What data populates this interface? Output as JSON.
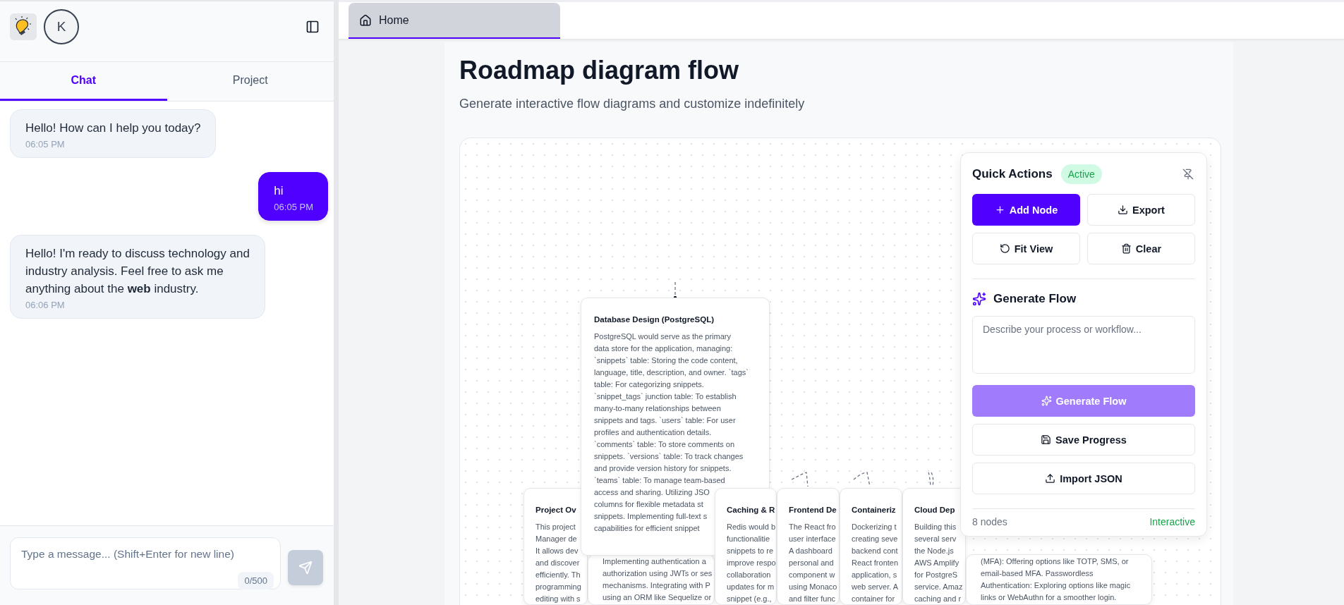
{
  "sidebar": {
    "avatar": "K",
    "tabs": [
      {
        "label": "Chat",
        "selected": true
      },
      {
        "label": "Project",
        "selected": false
      }
    ],
    "messages": [
      {
        "kind": "received",
        "text": "Hello! How can I help you today?",
        "time": "06:05 PM"
      },
      {
        "kind": "sent",
        "text": "hi",
        "time": "06:05 PM"
      },
      {
        "kind": "received",
        "text": "Hello! I'm ready to discuss technology and industry analysis. Feel free to ask me anything about the **web** industry.",
        "time": "06:06 PM"
      }
    ],
    "composer": {
      "placeholder": "Type a message... (Shift+Enter for new line)",
      "count": "0/500",
      "send_disabled": true
    }
  },
  "tabs": [
    {
      "label": "Home",
      "selected": true
    }
  ],
  "page": {
    "title": "Roadmap diagram flow",
    "subtitle": "Generate interactive flow diagrams and customize indefinitely"
  },
  "diagram": {
    "nodes": [
      {
        "title": "Database Design (PostgreSQL)",
        "lines": [
          "PostgreSQL would serve as the primary",
          "data store for the application, managing:",
          "`snippets` table: Storing the code content,",
          "language, title, description, and owner. `tags`",
          "table: For categorizing snippets.",
          "`snippet_tags` junction table: To establish",
          "many-to-many relationships between",
          "snippets and tags. `users` table: For user",
          "profiles and authentication details.",
          "`comments` table: To store comments on",
          "snippets. `versions` table: To track changes",
          "and provide version history for snippets.",
          "`teams` table: To manage team-based",
          "access and sharing. Utilizing JSO",
          "columns for flexible metadata st",
          "snippets. Implementing full-text s",
          "capabilities for efficient snippet"
        ]
      },
      {
        "title": "Project Ov",
        "lines": [
          "This project",
          "Manager de",
          "It allows dev",
          "and discover",
          "efficiently. Th",
          "programming",
          "editing with s"
        ]
      },
      {
        "lines": [
          "Implementing authentication a",
          "authorization using JWTs or ses",
          "mechanisms. Integrating with P",
          "using an ORM like Sequelize or"
        ]
      },
      {
        "title": "Caching & R",
        "lines": [
          "Redis would b",
          "functionalitie",
          "snippets to re",
          "improve respo",
          "collaboration",
          "updates for m",
          "snippet (e.g.,"
        ]
      },
      {
        "title": "Frontend De",
        "lines": [
          "The React fro",
          "user interface",
          "A dashboard",
          "personal and",
          "component w",
          "using Monaco",
          "and filter func"
        ]
      },
      {
        "title": "Containeriz",
        "lines": [
          "Dockerizing t",
          "creating seve",
          "backend cont",
          "React fronten",
          "application, s",
          "web server. A",
          "container for"
        ]
      },
      {
        "title": "Cloud Dep",
        "lines": [
          "Building this",
          "several serv",
          "the Node.js",
          "AWS Amplify",
          "for PostgreS",
          "service. Amaz",
          "caching and r"
        ]
      },
      {
        "lines": [
          "(MFA): Offering options like TOTP, SMS, or",
          "email-based MFA. Passwordless",
          "Authentication: Exploring options like magic",
          "links or WebAuthn for a smoother login."
        ]
      }
    ]
  },
  "quick_actions": {
    "title": "Quick Actions",
    "badge": "Active",
    "buttons": [
      {
        "label": "Add Node",
        "kind": "primary"
      },
      {
        "label": "Export",
        "kind": "outline"
      },
      {
        "label": "Fit View",
        "kind": "outline"
      },
      {
        "label": "Clear",
        "kind": "outline"
      }
    ],
    "generate": {
      "heading": "Generate Flow",
      "placeholder": "Describe your process or workflow...",
      "button": {
        "label": "Generate Flow",
        "disabled": true
      }
    },
    "more_buttons": [
      {
        "label": "Save Progress"
      },
      {
        "label": "Import JSON"
      }
    ],
    "node_count": "8 nodes",
    "status": "Interactive"
  }
}
